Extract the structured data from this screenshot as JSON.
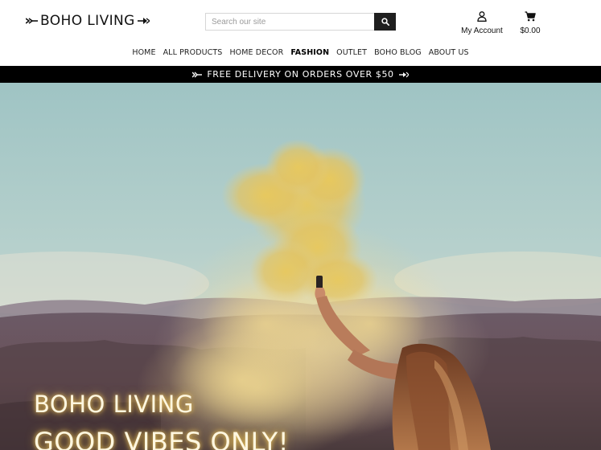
{
  "brand": {
    "name": "BOHO LIVING"
  },
  "search": {
    "placeholder": "Search our site",
    "button_icon": "search-icon"
  },
  "account": {
    "label": "My Account",
    "icon": "user-icon"
  },
  "cart": {
    "total": "$0.00",
    "icon": "cart-icon"
  },
  "nav": {
    "items": [
      {
        "label": "HOME"
      },
      {
        "label": "ALL PRODUCTS"
      },
      {
        "label": "HOME DECOR"
      },
      {
        "label": "FASHION",
        "active": true
      },
      {
        "label": "OUTLET"
      },
      {
        "label": "BOHO BLOG"
      },
      {
        "label": "ABOUT US"
      }
    ]
  },
  "promo": {
    "text": "FREE DELIVERY ON ORDERS OVER $50"
  },
  "hero": {
    "line1": "BOHO LIVING",
    "line2": "GOOD VIBES ONLY!",
    "glow_color": "#ffd060"
  },
  "colors": {
    "accent": "#1f1f1f",
    "promo_bg": "#000000"
  }
}
